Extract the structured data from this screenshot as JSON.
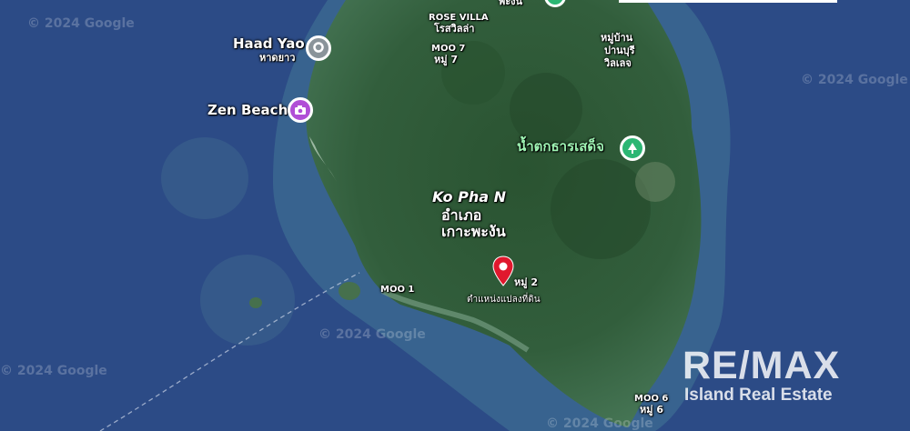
{
  "map": {
    "places": {
      "rose_villa": "ROSE VILLA",
      "rose_villa_th": "โรสวิลล่า",
      "moo7": "MOO 7",
      "moo7_th": "หมู่ 7",
      "village_th_1": "หมู่บ้าน",
      "village_th_2": "ปานบุรี",
      "village_th_3": "วิลเลจ",
      "haad_yao": "Haad Yao",
      "haad_yao_th": "หาดยาว",
      "zen_beach": "Zen Beach",
      "waterfall_th": "น้ำตกธารเสด็จ",
      "district_en": "Ko Pha N",
      "district_th_1": "อำเภอ",
      "district_th_2": "เกาะพะงัน",
      "moo2": "หมู่ 2",
      "location_th": "ตำแหน่งแปลงที่ดิน",
      "moo1": "MOO 1",
      "moo6": "MOO 6",
      "moo6_th": "หมู่ 6",
      "top_partial_th": "พะงัน"
    },
    "watermarks": {
      "w1": "© 2024 Google",
      "w2": "© 2024 Google",
      "w3": "© 2024 Google",
      "w4": "© 2024 Google",
      "w5": "© 2024 Google"
    },
    "icons": {
      "haad_yao": "location-icon",
      "zen_beach": "camera-icon",
      "waterfall": "tree-icon",
      "plot_marker": "map-pin-icon"
    },
    "colors": {
      "ocean": "#2c4b86",
      "reef": "#3a6a86",
      "land": "#2f5a38",
      "marker": "#e0182d",
      "poi_gray": "#8a949a",
      "poi_purple": "#b04ed6",
      "poi_green": "#2bb673"
    }
  },
  "brand": {
    "logo_main": "RE/MAX",
    "logo_sub": "Island Real Estate"
  }
}
